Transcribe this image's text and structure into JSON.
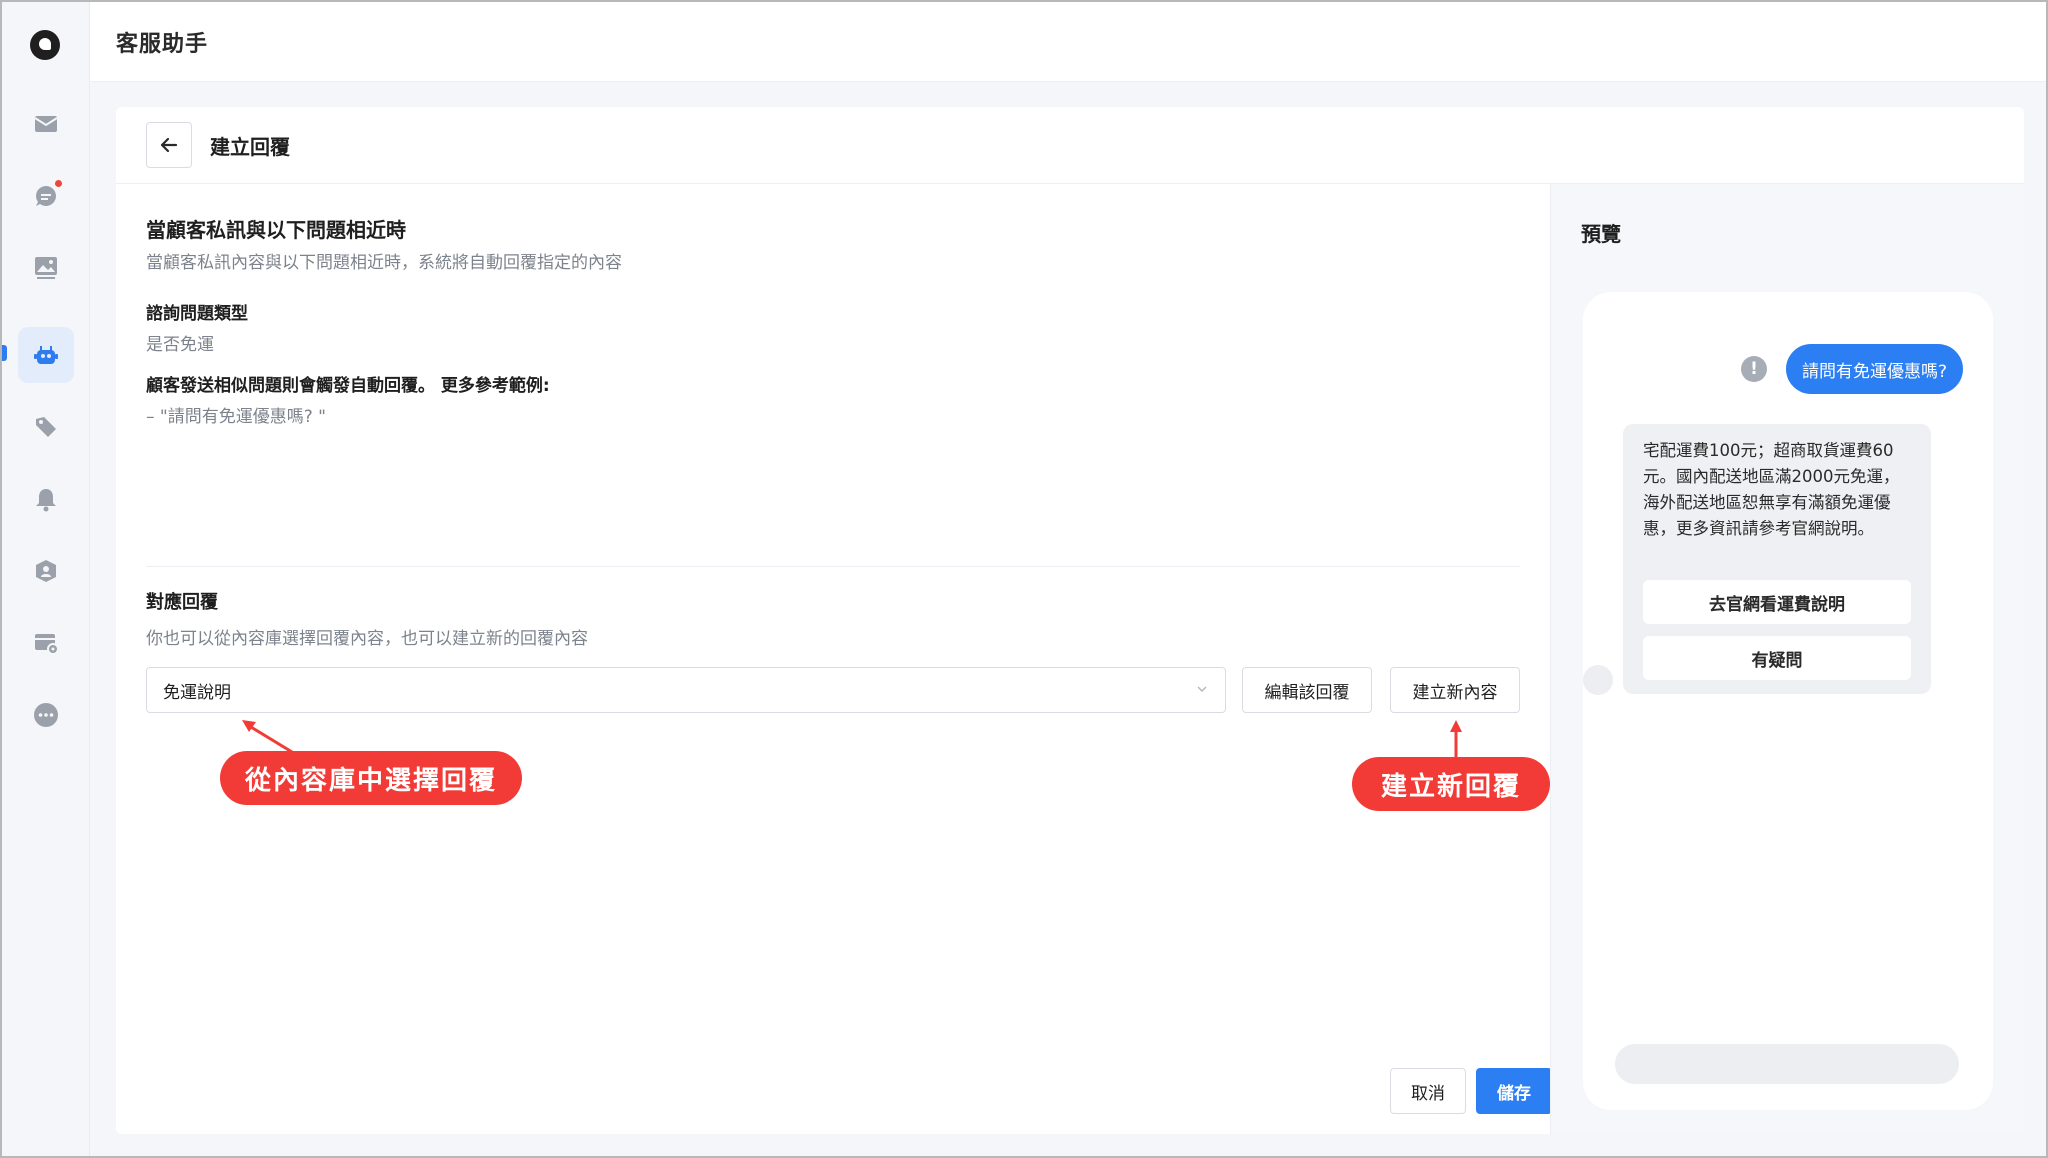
{
  "app": {
    "title": "客服助手"
  },
  "sidebar": {
    "items": [
      {
        "icon": "mail-icon"
      },
      {
        "icon": "chat-icon",
        "has_badge": true
      },
      {
        "icon": "image-icon"
      },
      {
        "icon": "robot-icon",
        "active": true
      },
      {
        "icon": "tag-icon"
      },
      {
        "icon": "bell-icon"
      },
      {
        "icon": "user-shield-icon"
      },
      {
        "icon": "settings-card-icon"
      },
      {
        "icon": "more-icon"
      }
    ]
  },
  "page": {
    "title": "建立回覆",
    "section1": {
      "heading": "當顧客私訊與以下問題相近時",
      "subheading": "當顧客私訊內容與以下問題相近時，系統將自動回覆指定的內容",
      "category_label": "諮詢問題類型",
      "category_value": "是否免運",
      "examples_label": "顧客發送相似問題則會觸發自動回覆。 更多參考範例:",
      "example_1": "– \"請問有免運優惠嗎? \""
    },
    "section2": {
      "heading": "對應回覆",
      "subheading": "你也可以從內容庫選擇回覆內容，也可以建立新的回覆內容",
      "select_value": "免運說明",
      "edit_button": "編輯該回覆",
      "create_button": "建立新內容"
    },
    "callouts": {
      "select_hint": "從內容庫中選擇回覆",
      "create_hint": "建立新回覆"
    },
    "footer": {
      "cancel": "取消",
      "save": "儲存"
    }
  },
  "preview": {
    "title": "預覽",
    "user_message": "請問有免運優惠嗎?",
    "bot_message": "宅配運費100元；超商取貨運費60元。國內配送地區滿2000元免運，海外配送地區恕無享有滿額免運優惠，更多資訊請參考官網說明。",
    "bot_buttons": [
      "去官網看運費說明",
      "有疑問"
    ]
  },
  "colors": {
    "accent": "#2b7ff2",
    "callout": "#f23b36",
    "badge": "#f0453a"
  }
}
